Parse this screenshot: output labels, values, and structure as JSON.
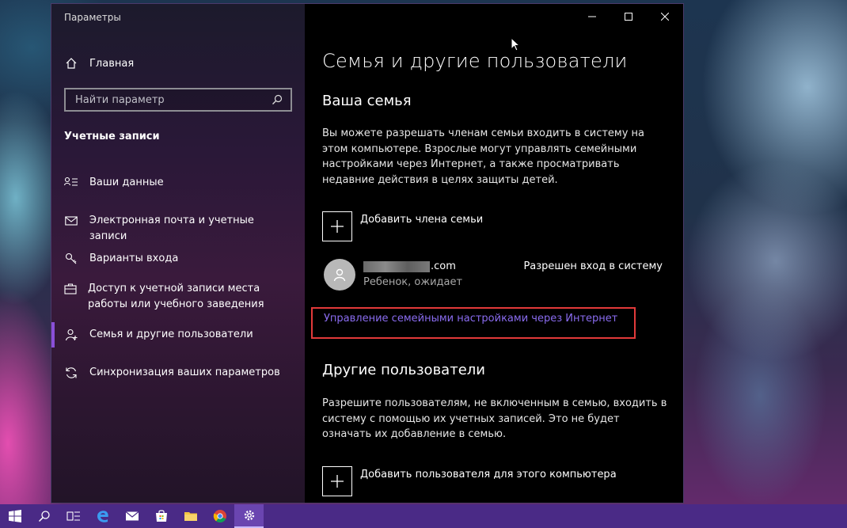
{
  "window": {
    "title": "Параметры"
  },
  "sidebar": {
    "home_label": "Главная",
    "search_placeholder": "Найти параметр",
    "section_title": "Учетные записи",
    "items": [
      {
        "label": "Ваши данные",
        "icon": "user-card-icon"
      },
      {
        "label": "Электронная почта и учетные записи",
        "icon": "mail-icon"
      },
      {
        "label": "Варианты входа",
        "icon": "key-icon"
      },
      {
        "label": "Доступ к учетной записи места работы или учебного заведения",
        "icon": "briefcase-icon"
      },
      {
        "label": "Семья и другие пользователи",
        "icon": "person-add-icon",
        "active": true
      },
      {
        "label": "Синхронизация ваших параметров",
        "icon": "sync-icon"
      }
    ]
  },
  "main": {
    "title": "Семья и другие пользователи",
    "family": {
      "heading": "Ваша семья",
      "description": "Вы можете разрешать членам семьи входить в систему на этом компьютере. Взрослые могут управлять семейными настройками через Интернет, а также просматривать недавние действия в целях защиты детей.",
      "add_label": "Добавить члена семьи",
      "member": {
        "email_suffix": ".com",
        "subtitle": "Ребенок, ожидает",
        "status": "Разрешен вход в систему"
      },
      "manage_link": "Управление семейными настройками через Интернет"
    },
    "others": {
      "heading": "Другие пользователи",
      "description": "Разрешите пользователям, не включенным в семью, входить в систему с помощью их учетных записей. Это не будет означать их добавление в семью.",
      "add_label": "Добавить пользователя для этого компьютера"
    }
  },
  "colors": {
    "accent": "#8a4fd8",
    "link": "#8a6cf0",
    "highlight": "#e23a3a",
    "taskbar": "#4a2a86"
  },
  "taskbar": {
    "items": [
      "windows-start-icon",
      "search-icon",
      "task-view-icon",
      "edge-icon",
      "mail-icon",
      "store-icon",
      "file-explorer-icon",
      "chrome-icon",
      "settings-gear-icon"
    ]
  }
}
